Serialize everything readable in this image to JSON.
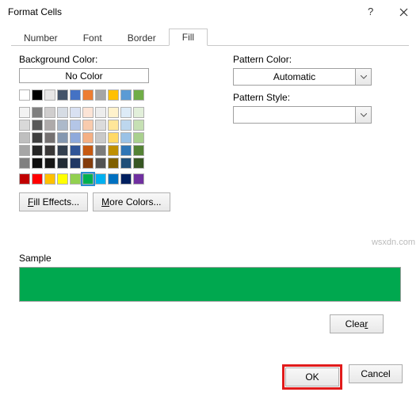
{
  "window": {
    "title": "Format Cells"
  },
  "tabs": {
    "number": "Number",
    "font": "Font",
    "border": "Border",
    "fill": "Fill",
    "active": "fill"
  },
  "fill": {
    "bg_label": "Background Color:",
    "nocolor": "No Color",
    "theme_row": [
      "#ffffff",
      "#000000",
      "#e7e6e6",
      "#44546a",
      "#4472c4",
      "#ed7d31",
      "#a5a5a5",
      "#ffc000",
      "#5b9bd5",
      "#70ad47"
    ],
    "theme_tints": [
      [
        "#f2f2f2",
        "#7f7f7f",
        "#d0cece",
        "#d6dce4",
        "#d9e1f2",
        "#fce4d6",
        "#ededed",
        "#fff2cc",
        "#ddebf7",
        "#e2efda"
      ],
      [
        "#d9d9d9",
        "#595959",
        "#aeaaaa",
        "#acb9ca",
        "#b4c6e7",
        "#f8cbad",
        "#dbdbdb",
        "#ffe699",
        "#bdd7ee",
        "#c6e0b4"
      ],
      [
        "#bfbfbf",
        "#404040",
        "#757171",
        "#8497b0",
        "#8ea9db",
        "#f4b084",
        "#c9c9c9",
        "#ffd966",
        "#9bc2e6",
        "#a9d08e"
      ],
      [
        "#a6a6a6",
        "#262626",
        "#3a3838",
        "#333f4f",
        "#305496",
        "#c65911",
        "#7b7b7b",
        "#bf8f00",
        "#2f75b5",
        "#548235"
      ],
      [
        "#808080",
        "#0d0d0d",
        "#161616",
        "#222b35",
        "#203764",
        "#833c0c",
        "#525252",
        "#806000",
        "#1f4e78",
        "#375623"
      ]
    ],
    "standard": [
      "#c00000",
      "#ff0000",
      "#ffc000",
      "#ffff00",
      "#92d050",
      "#00b050",
      "#00b0f0",
      "#0070c0",
      "#002060",
      "#7030a0"
    ],
    "selected_color": "#00b050",
    "fill_effects_label": "Fill Effects...",
    "more_colors_label": "More Colors...",
    "pattern_color_label": "Pattern Color:",
    "pattern_color_value": "Automatic",
    "pattern_style_label": "Pattern Style:",
    "pattern_style_value": "",
    "sample_label": "Sample",
    "sample_color": "#00a84f"
  },
  "buttons": {
    "clear": "Clear",
    "ok": "OK",
    "cancel": "Cancel"
  },
  "watermark": "wsxdn.com"
}
